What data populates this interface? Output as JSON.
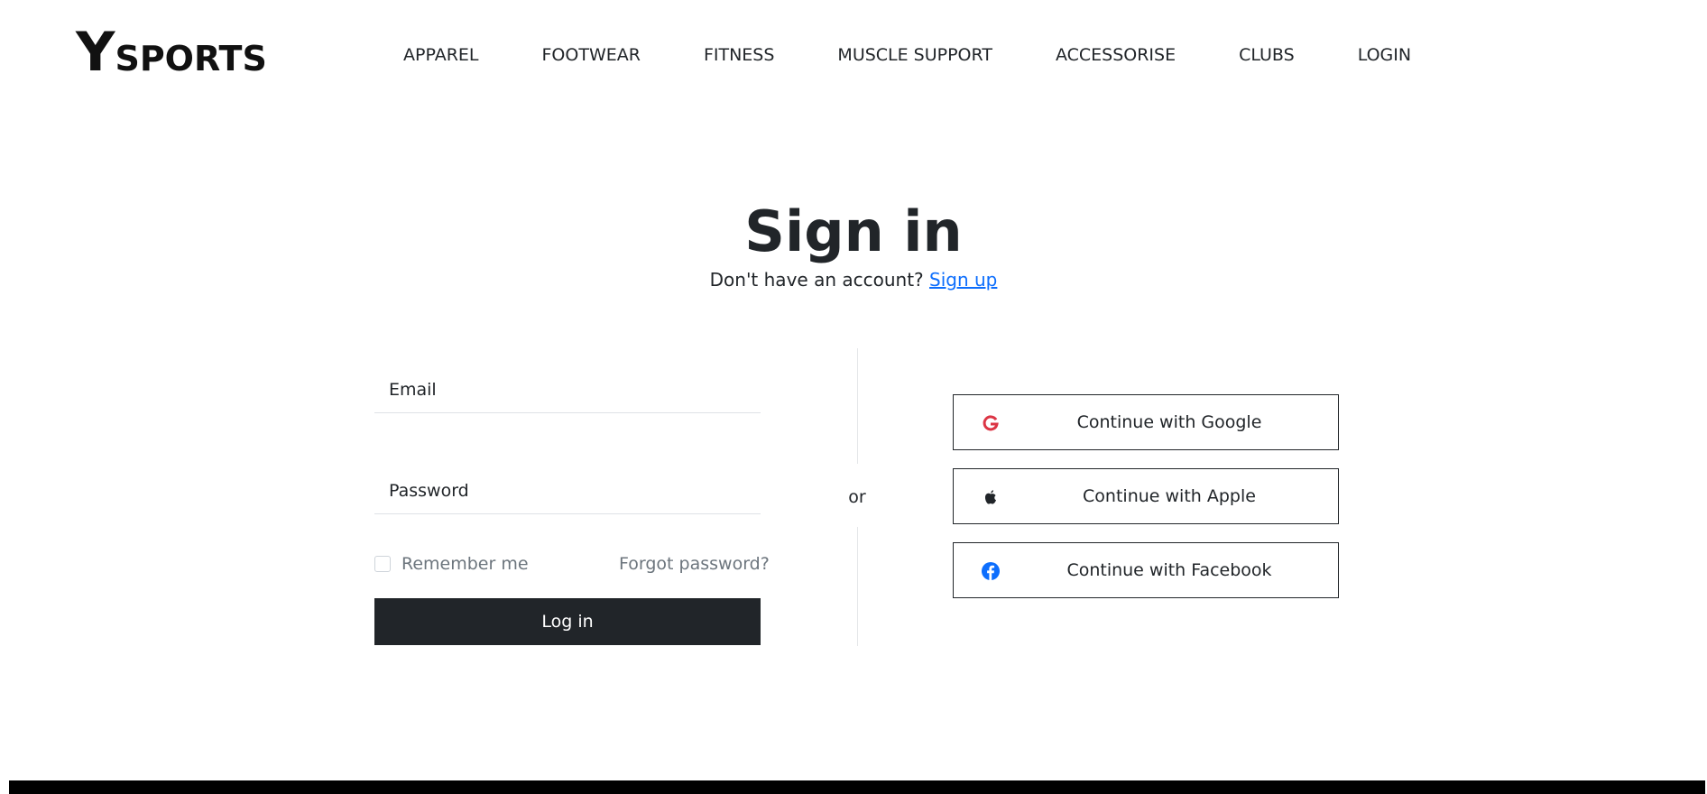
{
  "header": {
    "logo_big": "Y",
    "logo_rest": "SPORTS",
    "nav": [
      "APPAREL",
      "FOOTWEAR",
      "FITNESS",
      "MUSCLE SUPPORT",
      "ACCESSORISE",
      "CLUBS",
      "LOGIN"
    ]
  },
  "signin": {
    "title": "Sign in",
    "subtitle_text": "Don't have an account?",
    "signup_link": "Sign up",
    "email_placeholder": "Email",
    "password_placeholder": "Password",
    "remember_label": "Remember me",
    "remember_checked": false,
    "forgot_link": "Forgot password?",
    "login_button": "Log in",
    "divider_text": "or"
  },
  "social": {
    "google": {
      "label": "Continue with Google",
      "icon": "google-icon",
      "color": "#dc3545"
    },
    "apple": {
      "label": "Continue with Apple",
      "icon": "apple-icon",
      "color": "#212529"
    },
    "facebook": {
      "label": "Continue with Facebook",
      "icon": "facebook-icon",
      "color": "#0d6efd"
    }
  },
  "colors": {
    "primary_dark": "#212529",
    "link": "#0d6efd",
    "muted": "#6c757d",
    "footer": "#000000"
  }
}
